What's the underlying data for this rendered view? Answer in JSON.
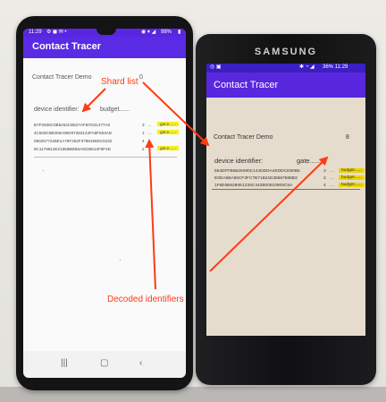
{
  "annotations": {
    "shard_list": "Shard list",
    "decoded_identifiers": "Decoded identifiers",
    "color": "#ff3b14"
  },
  "phone_left": {
    "status_time": "11:29",
    "status_right": "98%",
    "app_title": "Contact Tracer",
    "demo_label": "Contact Tracer Demo",
    "demo_value": "0",
    "col_identifier": "device identifier:",
    "col_tag": "budget......",
    "rows": [
      {
        "id": "B7F2936C0B5264CB827AFB7D31477A6",
        "n": "3",
        "el": "...",
        "tag": "gar.e......"
      },
      {
        "id": "4C829C8B206A90D97283124FA8F653AD",
        "n": "1",
        "el": "...",
        "tag": "gar.e......"
      },
      {
        "id": "0802577225E1A76F252F3788196DC6232",
        "n": "4",
        "el": "...",
        "tag": ""
      },
      {
        "id": "9C1178612E21955BEB6A9236813F8F4D",
        "n": "2",
        "el": "...",
        "tag": "gar.e......"
      }
    ],
    "nav_icons": [
      "recents-icon",
      "home-icon",
      "back-icon"
    ],
    "accent": "#5a2be4"
  },
  "phone_right": {
    "brand": "SAMSUNG",
    "status_right": "36% 11:29",
    "app_title": "Contact Tracer",
    "demo_label": "Contact Tracer Demo",
    "demo_value": "8",
    "col_identifier": "device identifier:",
    "col_tag": "gate......",
    "rows": [
      {
        "id": "564DFFB6B26090C144DDDA4EDDCD90B5",
        "n": "3",
        "el": "...",
        "tag": "budget......"
      },
      {
        "id": "E0DA6BA95CF3FC7B71B21E35687688B3",
        "n": "2",
        "el": "...",
        "tag": "budget......"
      },
      {
        "id": "1F6E6B6290E1236C442B00810909C5A",
        "n": "4",
        "el": "...",
        "tag": "budget......"
      }
    ],
    "accent": "#5827de",
    "screen_bg": "#e6dccd"
  }
}
